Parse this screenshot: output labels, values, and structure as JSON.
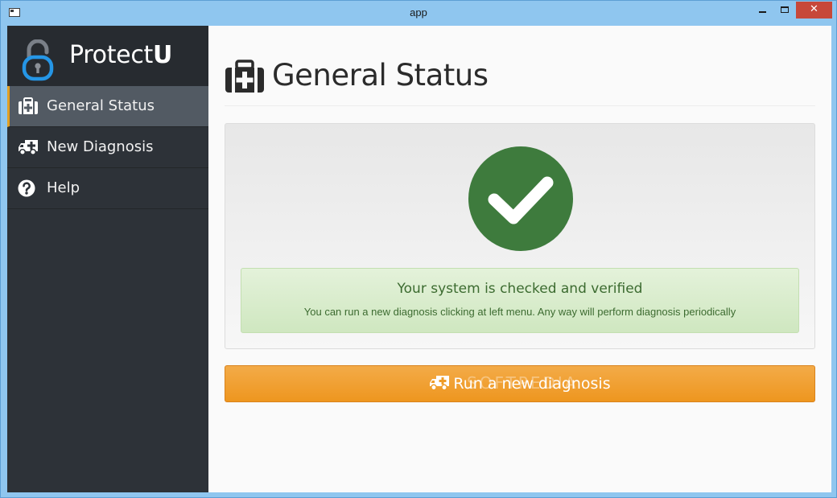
{
  "window": {
    "title": "app",
    "close_glyph": "✕"
  },
  "brand": {
    "name_plain": "Protect",
    "name_bold": "U",
    "icon": "padlock-icon",
    "accent": "#2596e6"
  },
  "sidebar": {
    "items": [
      {
        "label": "General Status",
        "icon": "medkit-icon",
        "active": true
      },
      {
        "label": "New Diagnosis",
        "icon": "ambulance-icon",
        "active": false
      },
      {
        "label": "Help",
        "icon": "question-circle-icon",
        "active": false
      }
    ]
  },
  "main": {
    "title": "General Status",
    "status": {
      "icon": "check-circle-icon",
      "color": "#3e7b3d",
      "heading": "Your system is checked and verified",
      "message": "You can run a new diagnosis clicking at left menu. Any way will perform diagnosis periodically"
    },
    "run_button": {
      "label": "Run a new diagnosis",
      "icon": "ambulance-icon",
      "color": "#ef9c27"
    },
    "watermark": "SOFTPEDIA"
  }
}
